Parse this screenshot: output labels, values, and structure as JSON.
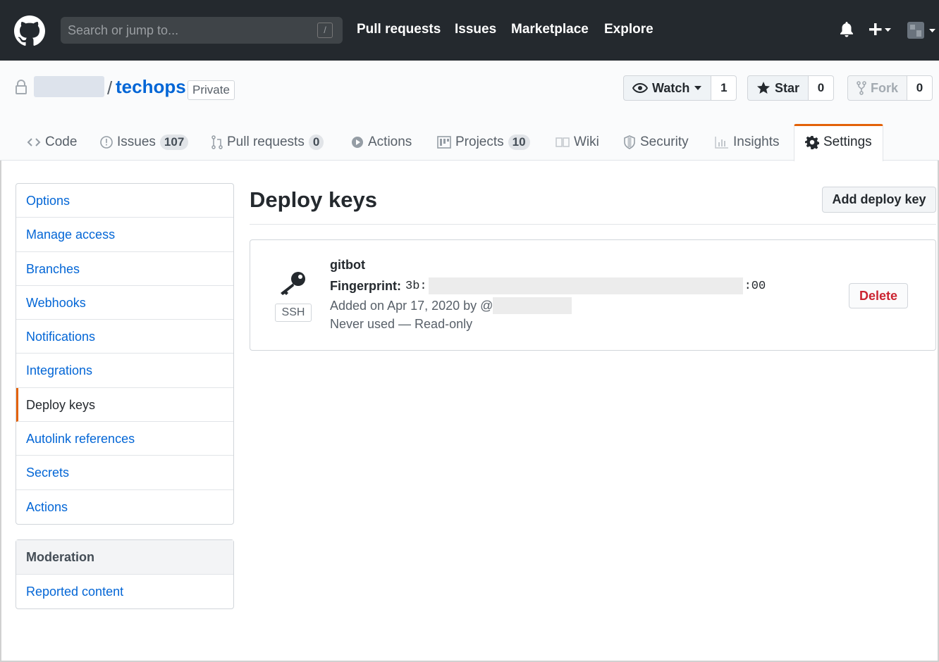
{
  "header": {
    "search_placeholder": "Search or jump to...",
    "search_shortcut": "/",
    "nav": [
      "Pull requests",
      "Issues",
      "Marketplace",
      "Explore"
    ]
  },
  "repo": {
    "separator": "/",
    "name": "techops",
    "visibility": "Private",
    "watch": {
      "label": "Watch",
      "count": "1"
    },
    "star": {
      "label": "Star",
      "count": "0"
    },
    "fork": {
      "label": "Fork",
      "count": "0"
    }
  },
  "tabs": [
    {
      "label": "Code",
      "icon": "code-icon"
    },
    {
      "label": "Issues",
      "count": "107",
      "icon": "issue-icon"
    },
    {
      "label": "Pull requests",
      "count": "0",
      "icon": "pull-request-icon"
    },
    {
      "label": "Actions",
      "icon": "play-icon"
    },
    {
      "label": "Projects",
      "count": "10",
      "icon": "project-icon"
    },
    {
      "label": "Wiki",
      "icon": "book-icon"
    },
    {
      "label": "Security",
      "icon": "shield-icon"
    },
    {
      "label": "Insights",
      "icon": "graph-icon"
    },
    {
      "label": "Settings",
      "icon": "gear-icon",
      "selected": true
    }
  ],
  "sidebar": {
    "items": [
      {
        "label": "Options"
      },
      {
        "label": "Manage access"
      },
      {
        "label": "Branches"
      },
      {
        "label": "Webhooks"
      },
      {
        "label": "Notifications"
      },
      {
        "label": "Integrations"
      },
      {
        "label": "Deploy keys",
        "selected": true
      },
      {
        "label": "Autolink references"
      },
      {
        "label": "Secrets"
      },
      {
        "label": "Actions"
      }
    ],
    "moderation_heading": "Moderation",
    "moderation_items": [
      {
        "label": "Reported content"
      }
    ]
  },
  "main": {
    "title": "Deploy keys",
    "add_button": "Add deploy key",
    "key": {
      "type": "SSH",
      "title": "gitbot",
      "fingerprint_label": "Fingerprint:",
      "fingerprint_start": "3b:",
      "fingerprint_end": ":00",
      "added": "Added on Apr 17, 2020 by @",
      "usage": "Never used — Read-only",
      "delete_label": "Delete"
    }
  },
  "colors": {
    "header_bg": "#24292e",
    "link": "#0366d6",
    "selected_accent": "#e36209",
    "danger": "#cb2431"
  }
}
